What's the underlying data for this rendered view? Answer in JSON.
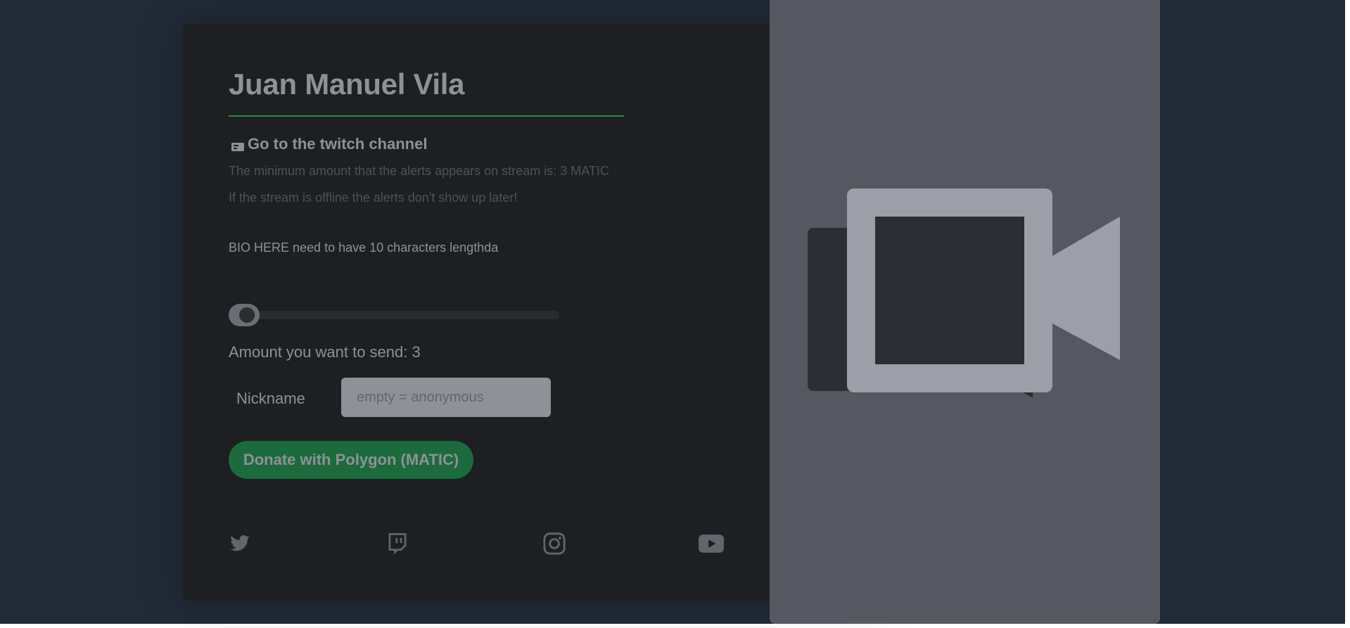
{
  "profile": {
    "name": "Juan Manuel Vila",
    "twitch_link": "Go to the twitch channel",
    "min_amount_note": "The minimum amount that the alerts appears on stream is: 3 MATIC",
    "offline_note": "If the stream is offline the alerts don't show up later!",
    "bio": "BIO HERE need to have 10 characters lengthda"
  },
  "donation": {
    "amount_label": "Amount you want to send: 3",
    "amount_value": 3,
    "slider_fraction": 0.0,
    "nickname_label": "Nickname",
    "nickname_placeholder": "empty = anonymous",
    "nickname_value": "",
    "donate_label": "Donate with Polygon (MATIC)"
  },
  "social_icons": [
    "twitter-icon",
    "twitch-icon",
    "instagram-icon",
    "youtube-icon"
  ],
  "overlay": {
    "icon": "video-camera-icon"
  },
  "colors": {
    "page_background": "#212a37",
    "card_background": "#1e1f22",
    "accent_green": "#1c6b3c",
    "text_muted": "#8e9197",
    "overlay": "#575762"
  }
}
